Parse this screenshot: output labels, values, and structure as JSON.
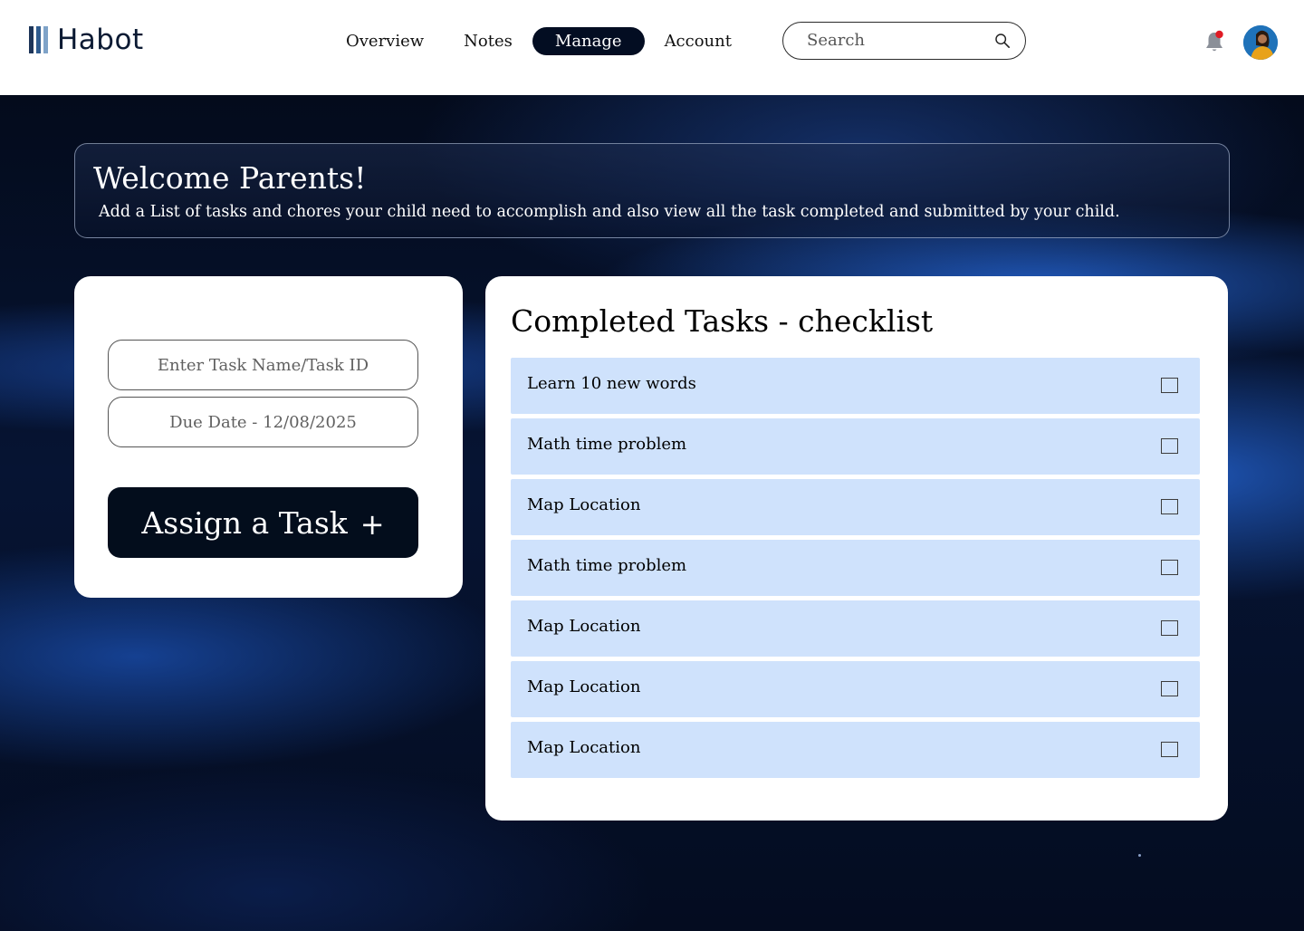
{
  "app": {
    "name": "Habot",
    "colors": {
      "logo_bars": [
        "#1d3559",
        "#2f5c8f",
        "#7fa3c8"
      ]
    }
  },
  "nav": {
    "items": [
      {
        "label": "Overview",
        "active": false
      },
      {
        "label": "Notes",
        "active": false
      },
      {
        "label": "Manage",
        "active": true
      },
      {
        "label": "Account",
        "active": false
      }
    ]
  },
  "search": {
    "placeholder": "Search",
    "icon": "magnifier-icon"
  },
  "notifications": {
    "icon": "bell-icon",
    "has_unread": true,
    "dot_color": "#e01b24"
  },
  "user": {
    "avatar": "user-avatar"
  },
  "welcome": {
    "title": "Welcome Parents!",
    "subtitle": "Add a List of tasks and chores your child need to accomplish and also view all the task completed and submitted by your child."
  },
  "assign": {
    "task_placeholder": "Enter Task Name/Task ID",
    "due_placeholder": "Due Date - 12/08/2025",
    "button_label": "Assign a Task",
    "button_icon": "+"
  },
  "checklist": {
    "title": "Completed Tasks - checklist",
    "items": [
      {
        "name": "Learn 10 new words",
        "checked": false
      },
      {
        "name": "Math time problem",
        "checked": false
      },
      {
        "name": "Map Location",
        "checked": false
      },
      {
        "name": "Math time problem",
        "checked": false
      },
      {
        "name": "Map Location",
        "checked": false
      },
      {
        "name": "Map Location",
        "checked": false
      },
      {
        "name": "Map Location",
        "checked": false
      }
    ]
  }
}
